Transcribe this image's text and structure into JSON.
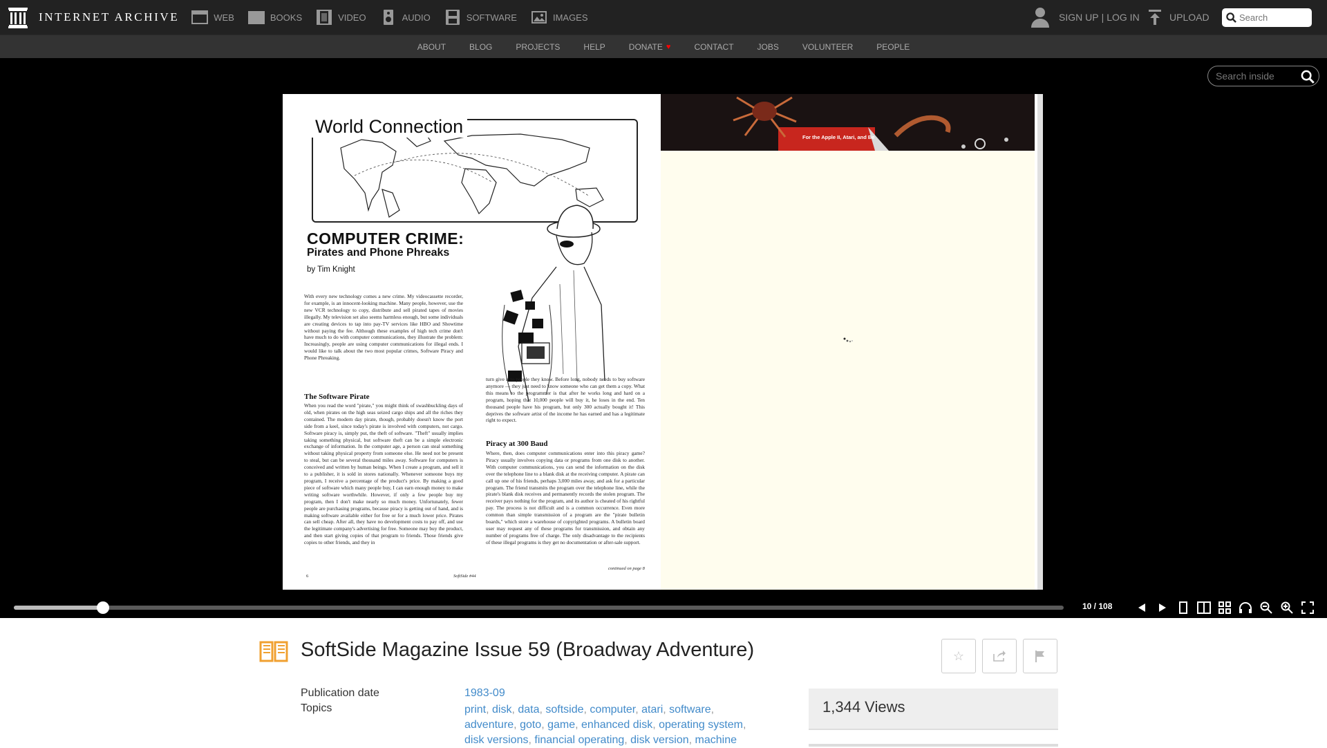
{
  "topnav": {
    "logo_text": "INTERNET ARCHIVE",
    "media": [
      {
        "label": "WEB",
        "icon": "web-icon"
      },
      {
        "label": "BOOKS",
        "icon": "books-icon"
      },
      {
        "label": "VIDEO",
        "icon": "video-icon"
      },
      {
        "label": "AUDIO",
        "icon": "audio-icon"
      },
      {
        "label": "SOFTWARE",
        "icon": "software-icon"
      },
      {
        "label": "IMAGES",
        "icon": "images-icon"
      }
    ],
    "signup": "SIGN UP",
    "separator": "|",
    "login": "LOG IN",
    "upload": "UPLOAD",
    "search_placeholder": "Search"
  },
  "subnav": [
    "ABOUT",
    "BLOG",
    "PROJECTS",
    "HELP",
    "DONATE",
    "CONTACT",
    "JOBS",
    "VOLUNTEER",
    "PEOPLE"
  ],
  "reader": {
    "search_inside_placeholder": "Search inside",
    "page_left": {
      "map_title": "World Connection",
      "title": "COMPUTER CRIME:",
      "subtitle": "Pirates and Phone Phreaks",
      "byline": "by Tim Knight",
      "intro": "With every new technology comes a new crime. My videocassette recorder, for example, is an innocent-looking machine. Many people, however, use the new VCR technology to copy, distribute and sell pirated tapes of movies illegally. My television set also seems harmless enough, but some individuals are creating devices to tap into pay-TV services like HBO and Showtime without paying the fee. Although these examples of high tech crime don't have much to do with computer communications, they illustrate the problem: Increasingly, people are using computer communications for illegal ends. I would like to talk about the two most popular crimes, Software Piracy and Phone Phreaking.",
      "section1_head": "The Software Pirate",
      "section1": "When you read the word \"pirate,\" you might think of swashbuckling days of old, when pirates on the high seas seized cargo ships and all the riches they contained. The modern day pirate, though, probably doesn't know the port side from a keel, since today's pirate is involved with computers, not cargo. Software piracy is, simply put, the theft of software. \"Theft\" usually implies taking something physical, but software theft can be a simple electronic exchange of information. In the computer age, a person can steal something without taking physical property from someone else. He need not be present to steal, but can be several thousand miles away. Software for computers is conceived and written by human beings. When I create a program, and sell it to a publisher, it is sold in stores nationally. Whenever someone buys my program, I receive a percentage of the product's price. By making a good piece of software which many people buy, I can earn enough money to make writing software worthwhile. However, if only a few people buy my program, then I don't make nearly so much money. Unfortunately, fewer people are purchasing programs, because piracy is getting out of hand, and is making software available either for free or for a much lower price. Pirates can sell cheap. After all, they have no development costs to pay off, and use the legitimate company's advertising for free. Someone may buy the product, and then start giving copies of that program to friends. Those friends give copies to other friends, and they in",
      "col2_top": "turn give it to people they know. Before long, nobody needs to buy software anymore — they just need to know someone who can get them a copy. What this means to the programmer is that after he works long and hard on a program, hoping that 10,000 people will buy it, he loses in the end. Ten thousand people have his program, but only 300 actually bought it! This deprives the software artist of the income he has earned and has a legitimate right to expect.",
      "section2_head": "Piracy at 300 Baud",
      "section2": "Where, then, does computer communications enter into this piracy game? Piracy usually involves copying data or programs from one disk to another. With computer communications, you can send the information on the disk over the telephone line to a blank disk at the receiving computer. A pirate can call up one of his friends, perhaps 3,000 miles away, and ask for a particular program. The friend transmits the program over the telephone line, while the pirate's blank disk receives and permanently records the stolen program. The receiver pays nothing for the program, and its author is cheated of his rightful pay. The process is not difficult and is a common occurrence. Even more common than simple transmission of a program are the \"pirate bulletin boards,\" which store a warehouse of copyrighted programs. A bulletin board user may request any of these programs for transmission, and obtain any number of programs free of charge. The only disadvantage to the recipients of these illegal programs is they get no documentation or after-sale support.",
      "continued": "continued on page 8",
      "page_num": "6",
      "footer": "SoftSide #44"
    },
    "page_right": {
      "banner_text": "For the Apple II, Atari, and Be"
    },
    "page_count": "10 / 108",
    "progress": 0.085
  },
  "item": {
    "title": "SoftSide Magazine Issue 59 (Broadway Adventure)",
    "pub_date_label": "Publication date",
    "pub_date": "1983-09",
    "topics_label": "Topics",
    "topics": [
      "print",
      "disk",
      "data",
      "softside",
      "computer",
      "atari",
      "software",
      "adventure",
      "goto",
      "game",
      "enhanced disk",
      "operating system",
      "disk versions",
      "financial operating",
      "disk version",
      "machine"
    ],
    "views": "1,344 Views"
  },
  "colors": {
    "topbar": "#222222",
    "subbar": "#333333",
    "link": "#428bca",
    "heart": "#ff0000"
  }
}
